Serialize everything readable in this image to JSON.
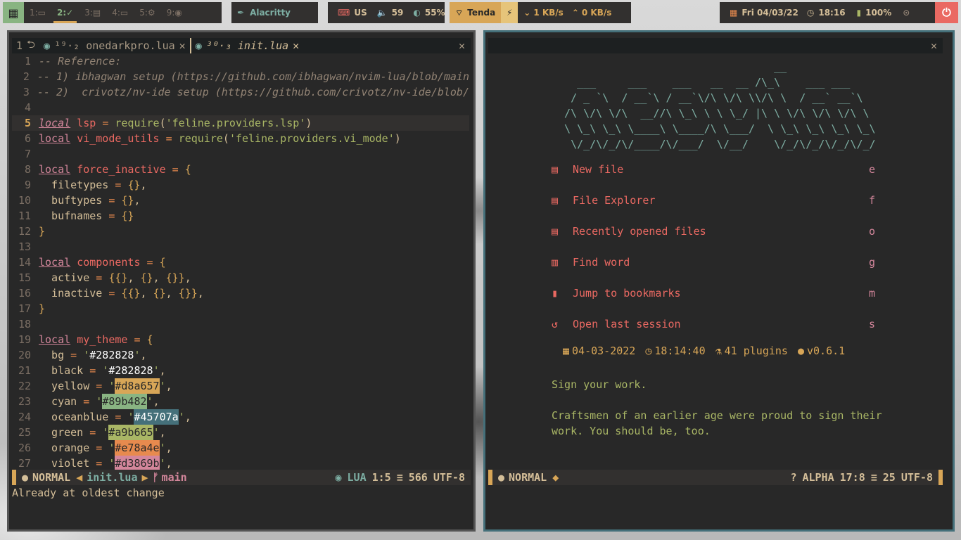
{
  "topbar": {
    "workspaces": [
      {
        "label": "1:▭"
      },
      {
        "label": "2:✓",
        "active": true
      },
      {
        "label": "3:▤"
      },
      {
        "label": "4:▭"
      },
      {
        "label": "5:⚙"
      },
      {
        "label": "9:◉"
      }
    ],
    "app_title": "Alacritty",
    "keyboard": "US",
    "volume": "59",
    "brightness": "55%",
    "wifi": "Tenda",
    "down": "1 KB/s",
    "up": "0 KB/s",
    "date": "Fri 04/03/22",
    "time": "18:16",
    "battery": "100%"
  },
  "left": {
    "tabs": [
      {
        "label": "1"
      },
      {
        "label": "¹⁹·₂ onedarkpro.lua"
      },
      {
        "label": "³⁰·₃ init.lua"
      }
    ],
    "statusline": {
      "mode": "NORMAL",
      "file": "init.lua",
      "branch": "main",
      "lang": "LUA",
      "pos": "1:5",
      "lines": "566",
      "enc": "UTF-8"
    },
    "cmdline": "Already at oldest change"
  },
  "right": {
    "buttons": [
      {
        "label": "New file",
        "key": "e"
      },
      {
        "label": "File Explorer",
        "key": "f"
      },
      {
        "label": "Recently opened files",
        "key": "o"
      },
      {
        "label": "Find word",
        "key": "g"
      },
      {
        "label": "Jump to bookmarks",
        "key": "m"
      },
      {
        "label": "Open last session",
        "key": "s"
      }
    ],
    "info": {
      "date": "04-03-2022",
      "time": "18:14:40",
      "plugins": "41 plugins",
      "version": "v0.6.1"
    },
    "quote_title": "Sign your work.",
    "quote_1": "Craftsmen of an earlier age were proud to sign their",
    "quote_2": "work. You should be, too.",
    "statusline": {
      "mode": "NORMAL",
      "ft": "ALPHA",
      "pos": "17:8",
      "lines": "25",
      "enc": "UTF-8"
    }
  },
  "colors": {
    "accent": "#d8a657",
    "cyan": "#89b482",
    "blue": "#45707a",
    "red": "#ea6962"
  }
}
